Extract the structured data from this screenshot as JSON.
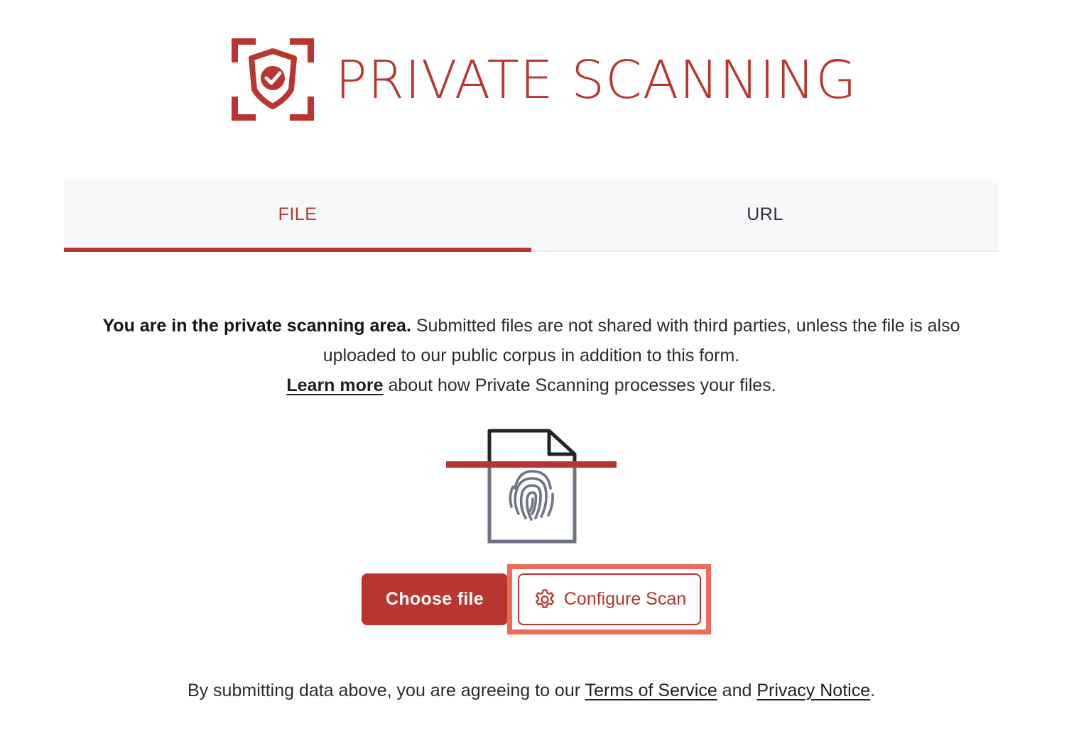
{
  "brand": {
    "title": "PRIVATE SCANNING",
    "color": "#b93530",
    "logo_icon": "shield-check-scan-icon"
  },
  "tabs": [
    {
      "label": "FILE",
      "active": true
    },
    {
      "label": "URL",
      "active": false
    }
  ],
  "info": {
    "bold_text": "You are in the private scanning area.",
    "text": " Submitted files are not shared with third parties, unless the file is also uploaded to our public corpus in addition to this form.",
    "link_label": "Learn more",
    "link_suffix": " about how Private Scanning processes your files."
  },
  "illustration": {
    "icon": "fingerprint-document-icon"
  },
  "actions": {
    "choose_label": "Choose file",
    "configure_label": "Configure Scan",
    "configure_icon": "gear-icon",
    "highlight_color": "#ee6a5b"
  },
  "legal": {
    "prefix": "By submitting data above, you are agreeing to our ",
    "terms_label": "Terms of Service",
    "middle": " and ",
    "privacy_label": "Privacy Notice",
    "suffix": "."
  }
}
